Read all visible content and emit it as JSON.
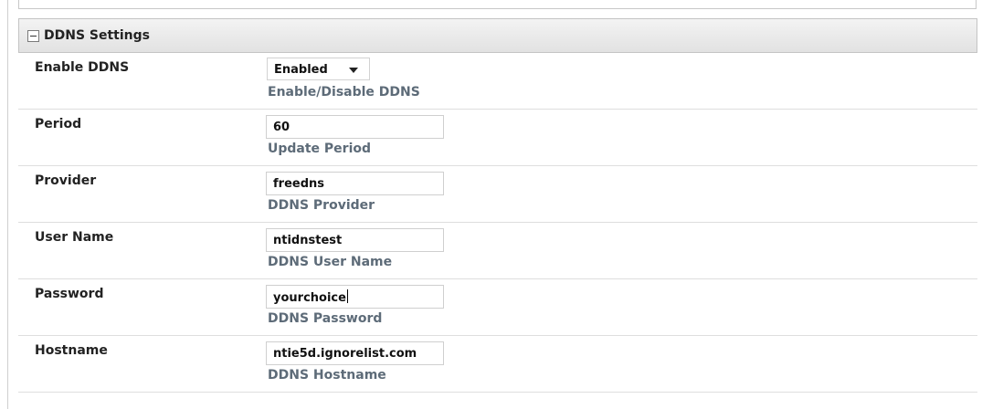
{
  "section": {
    "title": "DDNS Settings",
    "collapse_icon": "minus-box-icon"
  },
  "rows": [
    {
      "label": "Enable DDNS",
      "value": "Enabled",
      "hint": "Enable/Disable DDNS",
      "type": "select"
    },
    {
      "label": "Period",
      "value": "60",
      "hint": "Update Period",
      "type": "text"
    },
    {
      "label": "Provider",
      "value": "freedns",
      "hint": "DDNS Provider",
      "type": "text"
    },
    {
      "label": "User Name",
      "value": "ntidnstest",
      "hint": "DDNS User Name",
      "type": "text"
    },
    {
      "label": "Password",
      "value": "yourchoice",
      "hint": "DDNS Password",
      "type": "text"
    },
    {
      "label": "Hostname",
      "value": "ntie5d.ignorelist.com",
      "hint": "DDNS Hostname",
      "type": "text"
    }
  ]
}
